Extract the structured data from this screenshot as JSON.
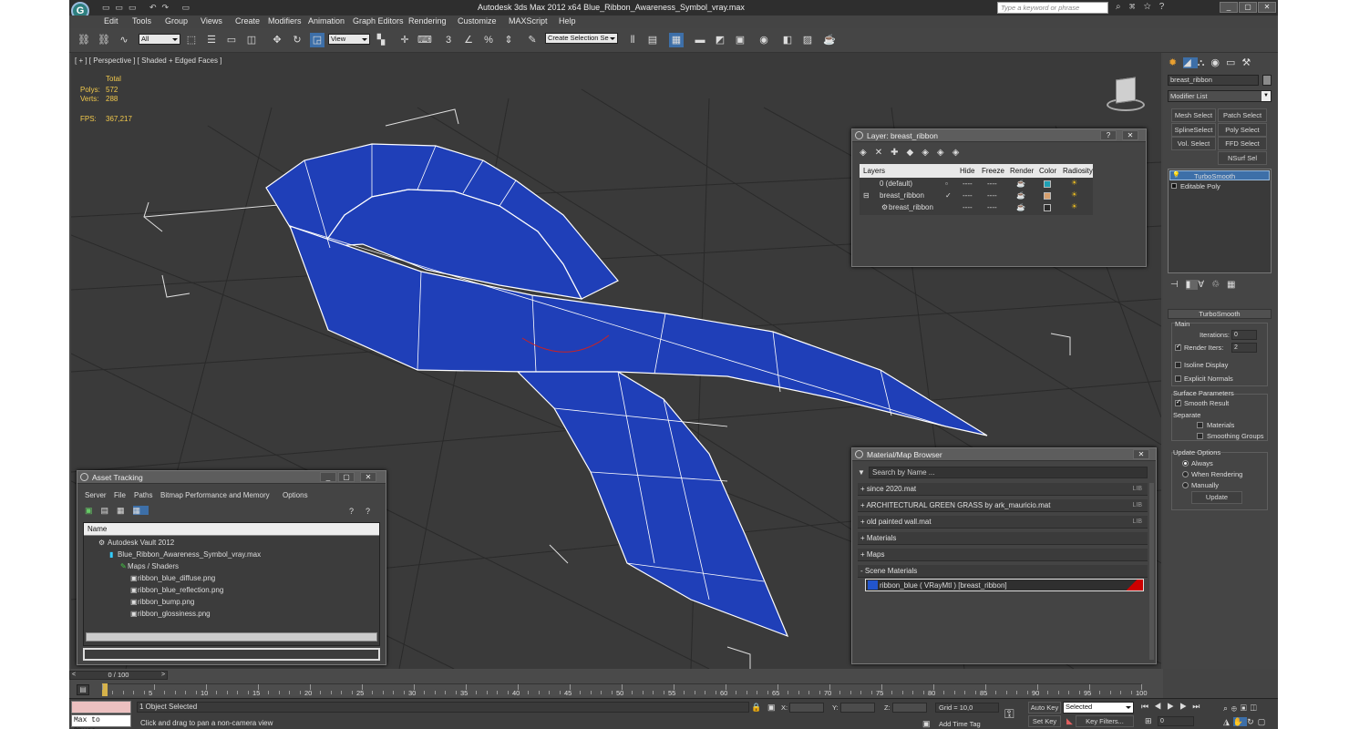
{
  "app": {
    "title": "Autodesk 3ds Max  2012 x64     Blue_Ribbon_Awareness_Symbol_vray.max",
    "search_placeholder": "Type a keyword or phrase"
  },
  "menu": [
    "Edit",
    "Tools",
    "Group",
    "Views",
    "Create",
    "Modifiers",
    "Animation",
    "Graph Editors",
    "Rendering",
    "Customize",
    "MAXScript",
    "Help"
  ],
  "toolbar": {
    "selection_filter": "All",
    "ref_coord": "View",
    "named_selection": "Create Selection Se"
  },
  "viewport": {
    "label": "[ + ] [ Perspective ] [ Shaded + Edged Faces ]",
    "stats": {
      "total_label": "Total",
      "polys_label": "Polys:",
      "polys": "572",
      "verts_label": "Verts:",
      "verts": "288",
      "fps_label": "FPS:",
      "fps": "367,217"
    }
  },
  "layer_window": {
    "title": "Layer: breast_ribbon",
    "columns": [
      "Layers",
      "Hide",
      "Freeze",
      "Render",
      "Color",
      "Radiosity"
    ],
    "rows": [
      {
        "name": "0 (default)",
        "hide": "----",
        "freeze": "----",
        "color": "#1ea0b4"
      },
      {
        "name": "breast_ribbon",
        "hide": "----",
        "freeze": "----",
        "color": "#d7a06e"
      },
      {
        "name": "breast_ribbon",
        "hide": "----",
        "freeze": "----",
        "color": "#2a2a2a"
      }
    ]
  },
  "material_browser": {
    "title": "Material/Map Browser",
    "search_placeholder": "Search by Name ...",
    "rows": [
      {
        "label": "+ since 2020.mat",
        "lib": "LIB"
      },
      {
        "label": "+ ARCHITECTURAL GREEN GRASS by ark_mauricio.mat",
        "lib": "LIB"
      },
      {
        "label": "+ old painted wall.mat",
        "lib": "LIB"
      },
      {
        "label": "+ Materials",
        "lib": ""
      },
      {
        "label": "+ Maps",
        "lib": ""
      },
      {
        "label": "- Scene Materials",
        "lib": ""
      }
    ],
    "scene_material": "ribbon_blue ( VRayMtl ) [breast_ribbon]"
  },
  "asset_tracking": {
    "title": "Asset Tracking",
    "menu": [
      "Server",
      "File",
      "Paths",
      "Bitmap Performance and Memory",
      "Options"
    ],
    "column": "Name",
    "items": [
      "Autodesk Vault 2012",
      "Blue_Ribbon_Awareness_Symbol_vray.max",
      "Maps / Shaders",
      "ribbon_blue_diffuse.png",
      "ribbon_blue_reflection.png",
      "ribbon_bump.png",
      "ribbon_glossiness.png"
    ]
  },
  "command_panel": {
    "object_name": "breast_ribbon",
    "modifier_list": "Modifier List",
    "buttons": [
      "Mesh Select",
      "Patch Select",
      "SplineSelect",
      "Poly Select",
      "Vol. Select",
      "FFD Select",
      "NSurf Sel"
    ],
    "stack": [
      "TurboSmooth",
      "Editable Poly"
    ],
    "rollout": "TurboSmooth",
    "main": "Main",
    "iterations_label": "Iterations:",
    "iterations": "0",
    "render_iters_label": "Render Iters:",
    "render_iters": "2",
    "isoline": "Isoline Display",
    "explicit": "Explicit Normals",
    "surface": "Surface Parameters",
    "smooth_result": "Smooth Result",
    "separate": "Separate",
    "materials": "Materials",
    "smoothing_groups": "Smoothing Groups",
    "update_options": "Update Options",
    "always": "Always",
    "when_rendering": "When Rendering",
    "manually": "Manually",
    "update": "Update"
  },
  "timeline": {
    "frame": "0 / 100",
    "ticks": [
      "0",
      "5",
      "10",
      "15",
      "20",
      "25",
      "30",
      "35",
      "40",
      "45",
      "50",
      "55",
      "60",
      "65",
      "70",
      "75",
      "80",
      "85",
      "90",
      "95",
      "100"
    ]
  },
  "status": {
    "selection": "1 Object Selected",
    "prompt": "Click and drag to pan a non-camera view",
    "script": "Max to Physc.",
    "x_label": "X:",
    "y_label": "Y:",
    "z_label": "Z:",
    "grid": "Grid = 10,0",
    "auto_key": "Auto Key",
    "selected": "Selected",
    "set_key": "Set Key",
    "key_filters": "Key Filters...",
    "add_time_tag": "Add Time Tag",
    "frame_field": "0"
  }
}
